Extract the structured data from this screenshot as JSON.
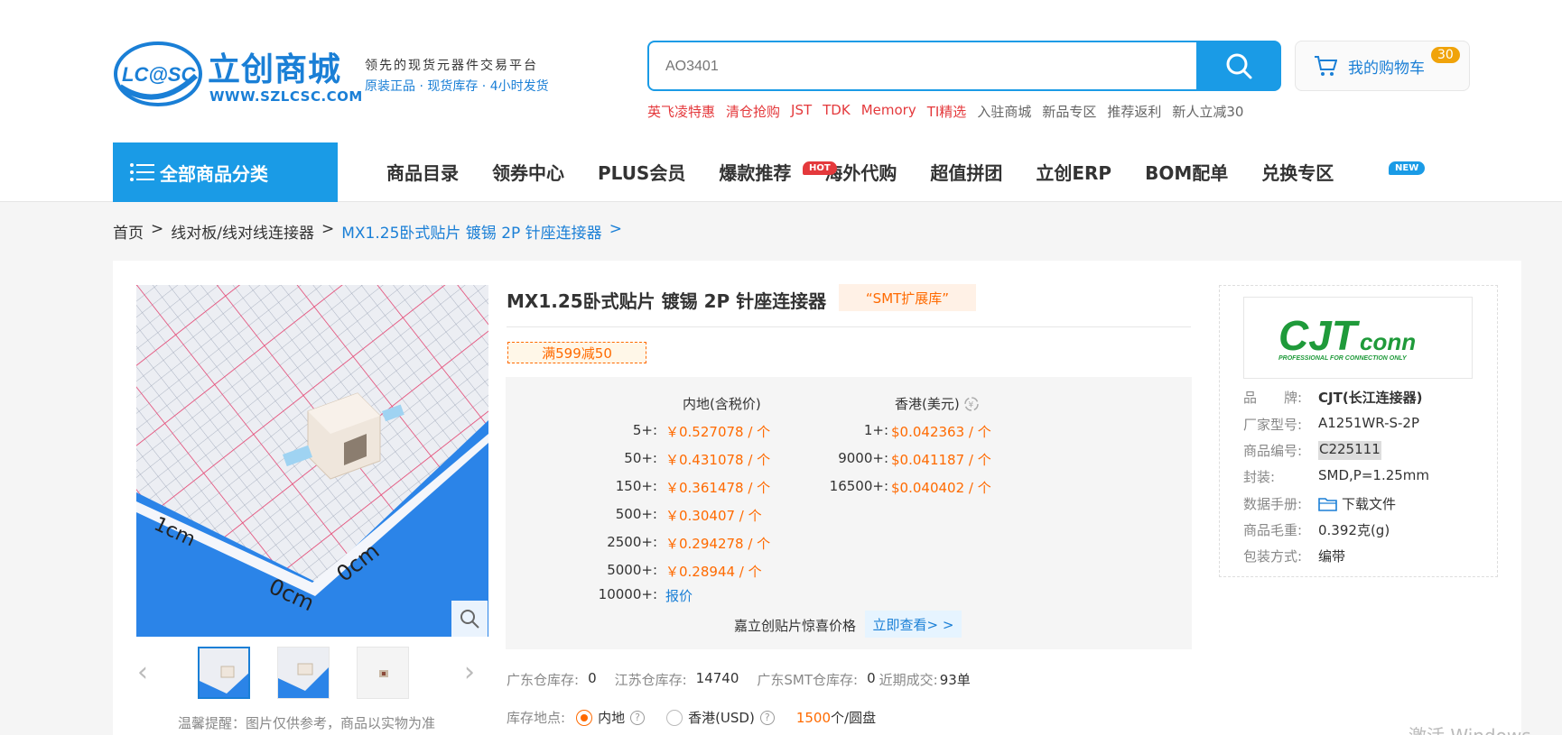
{
  "header": {
    "logo_title": "立创商城",
    "logo_url": "WWW.SZLCSC.COM",
    "slogan_line1": "领先的现货元器件交易平台",
    "slogan_line2": "原装正品 · 现货库存 · 4小时发货",
    "search_placeholder": "AO3401",
    "cart_label": "我的购物车",
    "cart_count": "30",
    "hotwords": [
      {
        "label": "英飞凌特惠",
        "color": "#e4393c"
      },
      {
        "label": "清仓抢购",
        "color": "#e4393c"
      },
      {
        "label": "JST",
        "color": "#e4393c"
      },
      {
        "label": "TDK",
        "color": "#e4393c"
      },
      {
        "label": "Memory",
        "color": "#e4393c"
      },
      {
        "label": "TI精选",
        "color": "#e4393c"
      },
      {
        "label": "入驻商城",
        "color": "#666666"
      },
      {
        "label": "新品专区",
        "color": "#666666"
      },
      {
        "label": "推荐返利",
        "color": "#666666"
      },
      {
        "label": "新人立减30",
        "color": "#666666"
      }
    ]
  },
  "nav": {
    "all_categories": "全部商品分类",
    "items": [
      "商品目录",
      "领券中心",
      "PLUS会员",
      "爆款推荐",
      "海外代购",
      "超值拼团",
      "立创ERP",
      "BOM配单",
      "兑换专区"
    ],
    "hot_badge": "HOT",
    "new_badge": "NEW"
  },
  "breadcrumb": {
    "home": "首页",
    "category": "线对板/线对线连接器",
    "current": "MX1.25卧式贴片 镀锡 2P 针座连接器",
    "sep": ">"
  },
  "product": {
    "title": "MX1.25卧式贴片 镀锡 2P 针座连接器",
    "tag": "“SMT扩展库”",
    "promo": "满599减50",
    "image_note": "温馨提醒：图片仅供参考，商品以实物为准",
    "price_head_cn": "内地(含税价)",
    "price_head_hk": "香港(美元)",
    "tiers_cn": [
      {
        "qty": "5+:",
        "price": "￥0.527078 / 个"
      },
      {
        "qty": "50+:",
        "price": "￥0.431078 / 个"
      },
      {
        "qty": "150+:",
        "price": "￥0.361478 / 个"
      },
      {
        "qty": "500+:",
        "price": "￥0.30407 / 个"
      },
      {
        "qty": "2500+:",
        "price": "￥0.294278 / 个"
      },
      {
        "qty": "5000+:",
        "price": "￥0.28944 / 个"
      },
      {
        "qty": "10000+:",
        "price": "报价"
      }
    ],
    "tiers_hk": [
      {
        "qty": "1+:",
        "price": "$0.042363 / 个"
      },
      {
        "qty": "9000+:",
        "price": "$0.041187 / 个"
      },
      {
        "qty": "16500+:",
        "price": "$0.040402 / 个"
      }
    ],
    "jlc_text": "嘉立创贴片惊喜价格",
    "jlc_button": "立即查看> >",
    "stock": [
      {
        "label": "广东仓库存:",
        "value": "0"
      },
      {
        "label": "江苏仓库存:",
        "value": "14740"
      },
      {
        "label": "广东SMT仓库存:",
        "value": "0"
      },
      {
        "label": "近期成交:",
        "value": "93单"
      }
    ],
    "location_label": "库存地点:",
    "loc_mainland": "内地",
    "loc_hk": "香港(USD)",
    "reel_qty": "1500",
    "reel_unit": "个/圆盘"
  },
  "specs": {
    "brand_logo_text": "CJTconn",
    "brand_logo_sub": "PROFESSIONAL FOR CONNECTION ONLY",
    "rows": [
      {
        "k": "品　　牌:",
        "v": "CJT(长江连接器)"
      },
      {
        "k": "厂家型号:",
        "v": "A1251WR-S-2P"
      },
      {
        "k": "商品编号:",
        "v": "C225111"
      },
      {
        "k": "封装:",
        "v": "SMD,P=1.25mm"
      },
      {
        "k": "数据手册:",
        "v": "下载文件"
      },
      {
        "k": "商品毛重:",
        "v": "0.392克(g)"
      },
      {
        "k": "包装方式:",
        "v": "编带"
      }
    ]
  },
  "watermark": "激活 Windows",
  "colors": {
    "accent": "#1a9be6",
    "price": "#ff6a00",
    "hot": "#e4393c"
  }
}
